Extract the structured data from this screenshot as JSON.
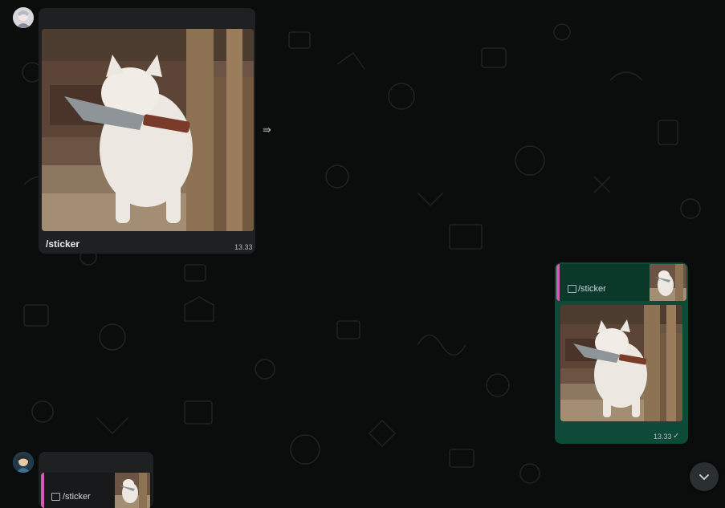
{
  "messages": {
    "incoming_1": {
      "caption": "/sticker",
      "time": "13.33"
    },
    "outgoing_1": {
      "quote_text": "/sticker",
      "time": "13.33",
      "status": "✓"
    },
    "incoming_2": {
      "quote_text": "/sticker"
    }
  },
  "icons": {
    "forward": "forward-icon",
    "scroll_down": "chevron-down-icon",
    "image": "image-icon"
  },
  "colors": {
    "background": "#0b0c0c",
    "incoming_bubble": "#1f2022",
    "outgoing_bubble": "#0d4a37",
    "quote_accent": "#d45bb0"
  }
}
